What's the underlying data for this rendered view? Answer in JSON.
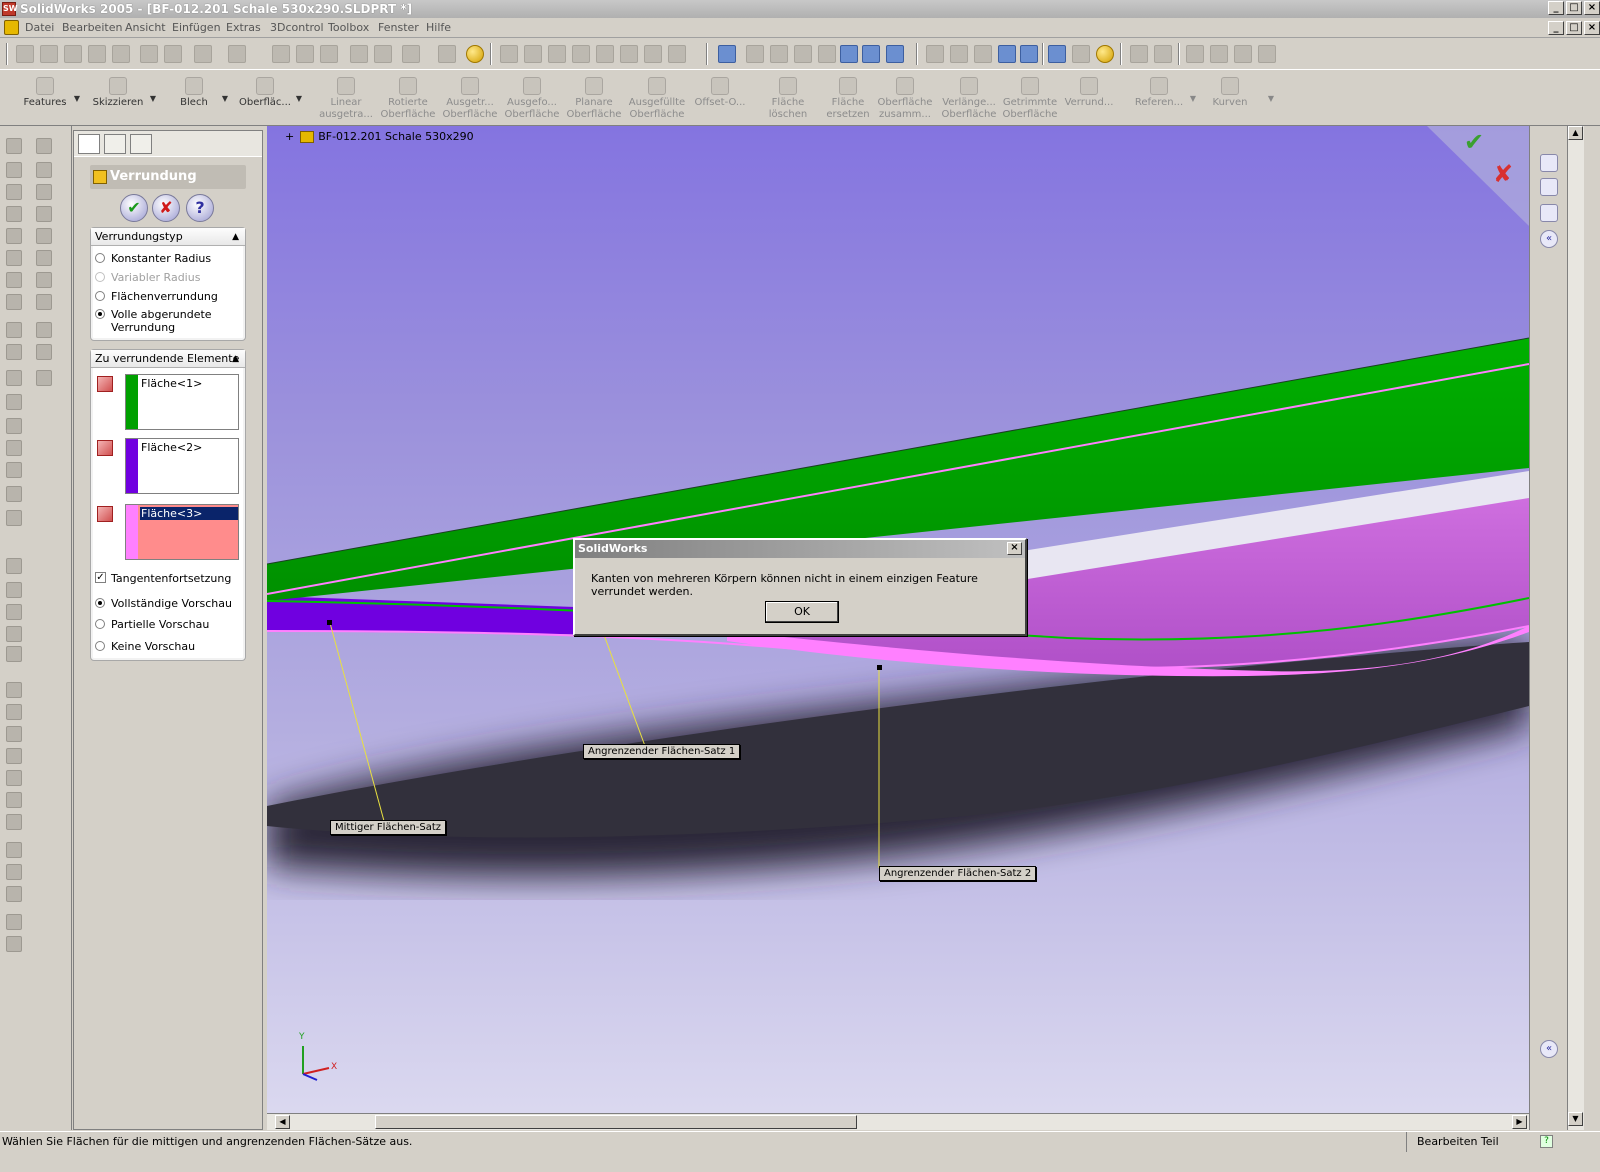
{
  "window": {
    "title": "SolidWorks 2005 - [BF-012.201 Schale 530x290.SLDPRT *]",
    "app_icon": "SW"
  },
  "menu": [
    "Datei",
    "Bearbeiten",
    "Ansicht",
    "Einfügen",
    "Extras",
    "3Dcontrol",
    "Toolbox",
    "Fenster",
    "Hilfe"
  ],
  "command_manager": [
    {
      "label1": "Features",
      "label2": ""
    },
    {
      "label1": "Skizzieren",
      "label2": ""
    },
    {
      "label1": "Blech",
      "label2": ""
    },
    {
      "label1": "Oberfläc...",
      "label2": ""
    },
    {
      "label1": "Linear",
      "label2": "ausgetra..."
    },
    {
      "label1": "Rotierte",
      "label2": "Oberfläche"
    },
    {
      "label1": "Ausgetr...",
      "label2": "Oberfläche"
    },
    {
      "label1": "Ausgefo...",
      "label2": "Oberfläche"
    },
    {
      "label1": "Planare",
      "label2": "Oberfläche"
    },
    {
      "label1": "Ausgefüllte",
      "label2": "Oberfläche"
    },
    {
      "label1": "Offset-O...",
      "label2": ""
    },
    {
      "label1": "Fläche",
      "label2": "löschen"
    },
    {
      "label1": "Fläche",
      "label2": "ersetzen"
    },
    {
      "label1": "Oberfläche",
      "label2": "zusamm..."
    },
    {
      "label1": "Verlänge...",
      "label2": "Oberfläche"
    },
    {
      "label1": "Getrimmte",
      "label2": "Oberfläche"
    },
    {
      "label1": "Verrund...",
      "label2": ""
    },
    {
      "label1": "Referen...",
      "label2": ""
    },
    {
      "label1": "Kurven",
      "label2": ""
    }
  ],
  "property_manager": {
    "title": "Verrundung",
    "ok_symbol": "✔",
    "cancel_symbol": "✘",
    "help_symbol": "?",
    "fillet_type": {
      "header": "Verrundungstyp",
      "options": [
        {
          "label": "Konstanter Radius",
          "selected": false,
          "disabled": false
        },
        {
          "label": "Variabler Radius",
          "selected": false,
          "disabled": true
        },
        {
          "label": "Flächenverrundung",
          "selected": false,
          "disabled": false
        },
        {
          "label": "Volle abgerundete Verrundung",
          "selected": true,
          "disabled": false
        }
      ]
    },
    "items": {
      "header": "Zu verrundende Elemente",
      "faces": [
        {
          "label": "Fläche<1>",
          "color": "#00a000",
          "selected": false
        },
        {
          "label": "Fläche<2>",
          "color": "#7000e0",
          "selected": false
        },
        {
          "label": "Fläche<3>",
          "color": "#ff80ff",
          "selected": true
        }
      ]
    },
    "tangent_propagation": {
      "label": "Tangentenfortsetzung",
      "checked": true
    },
    "preview": [
      {
        "label": "Vollständige Vorschau",
        "selected": true
      },
      {
        "label": "Partielle Vorschau",
        "selected": false
      },
      {
        "label": "Keine Vorschau",
        "selected": false
      }
    ]
  },
  "viewport": {
    "doc_title": "BF-012.201 Schale 530x290",
    "tree_expander": "+",
    "callouts": {
      "mid": "Mittiger Flächen-Satz",
      "adj1": "Angrenzender Flächen-Satz 1",
      "adj2": "Angrenzender Flächen-Satz 2"
    },
    "axes": {
      "y": "Y",
      "x": "X"
    },
    "confirm_ok_symbol": "✔",
    "confirm_cancel_symbol": "✘"
  },
  "dialog": {
    "title": "SolidWorks",
    "message": "Kanten von mehreren Körpern können nicht in einem einzigen Feature verrundet werden.",
    "ok_label": "OK",
    "close_symbol": "×"
  },
  "statusbar": {
    "message": "Wählen Sie Flächen für die mittigen und angrenzenden Flächen-Sätze aus.",
    "mode": "Bearbeiten Teil"
  },
  "colors": {
    "face1": "#00a000",
    "face2": "#7000e0",
    "face3": "#ff80ff",
    "mid_face": "#cc66dd",
    "viewport_top": "#8474e0"
  }
}
